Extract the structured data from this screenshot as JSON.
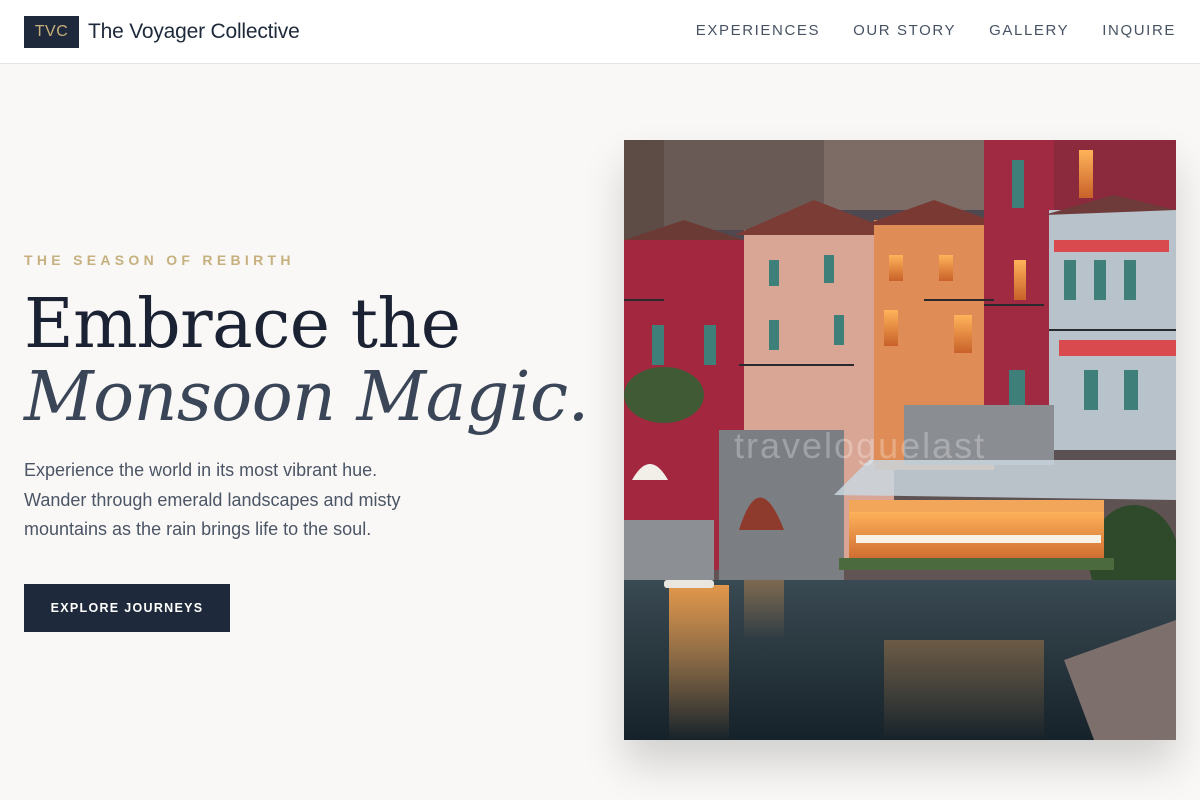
{
  "header": {
    "brand_badge": "TVC",
    "brand_name": "The Voyager Collective",
    "nav": [
      {
        "label": "EXPERIENCES"
      },
      {
        "label": "OUR STORY"
      },
      {
        "label": "GALLERY"
      },
      {
        "label": "INQUIRE"
      }
    ]
  },
  "hero": {
    "eyebrow": "THE SEASON OF REBIRTH",
    "title_line1": "Embrace the",
    "title_line2": "Monsoon Magic.",
    "description_lines": [
      "Experience the world in its most vibrant hue.",
      "Wander through emerald landscapes and misty",
      "mountains as the rain brings life to the soul."
    ],
    "cta_label": "EXPLORE JOURNEYS",
    "image_watermark": "traveloguelast"
  },
  "colors": {
    "navy": "#1e2a3c",
    "gold_accent": "#c7b07f",
    "page_background": "#f9f8f6",
    "header_background": "#ffffff"
  }
}
